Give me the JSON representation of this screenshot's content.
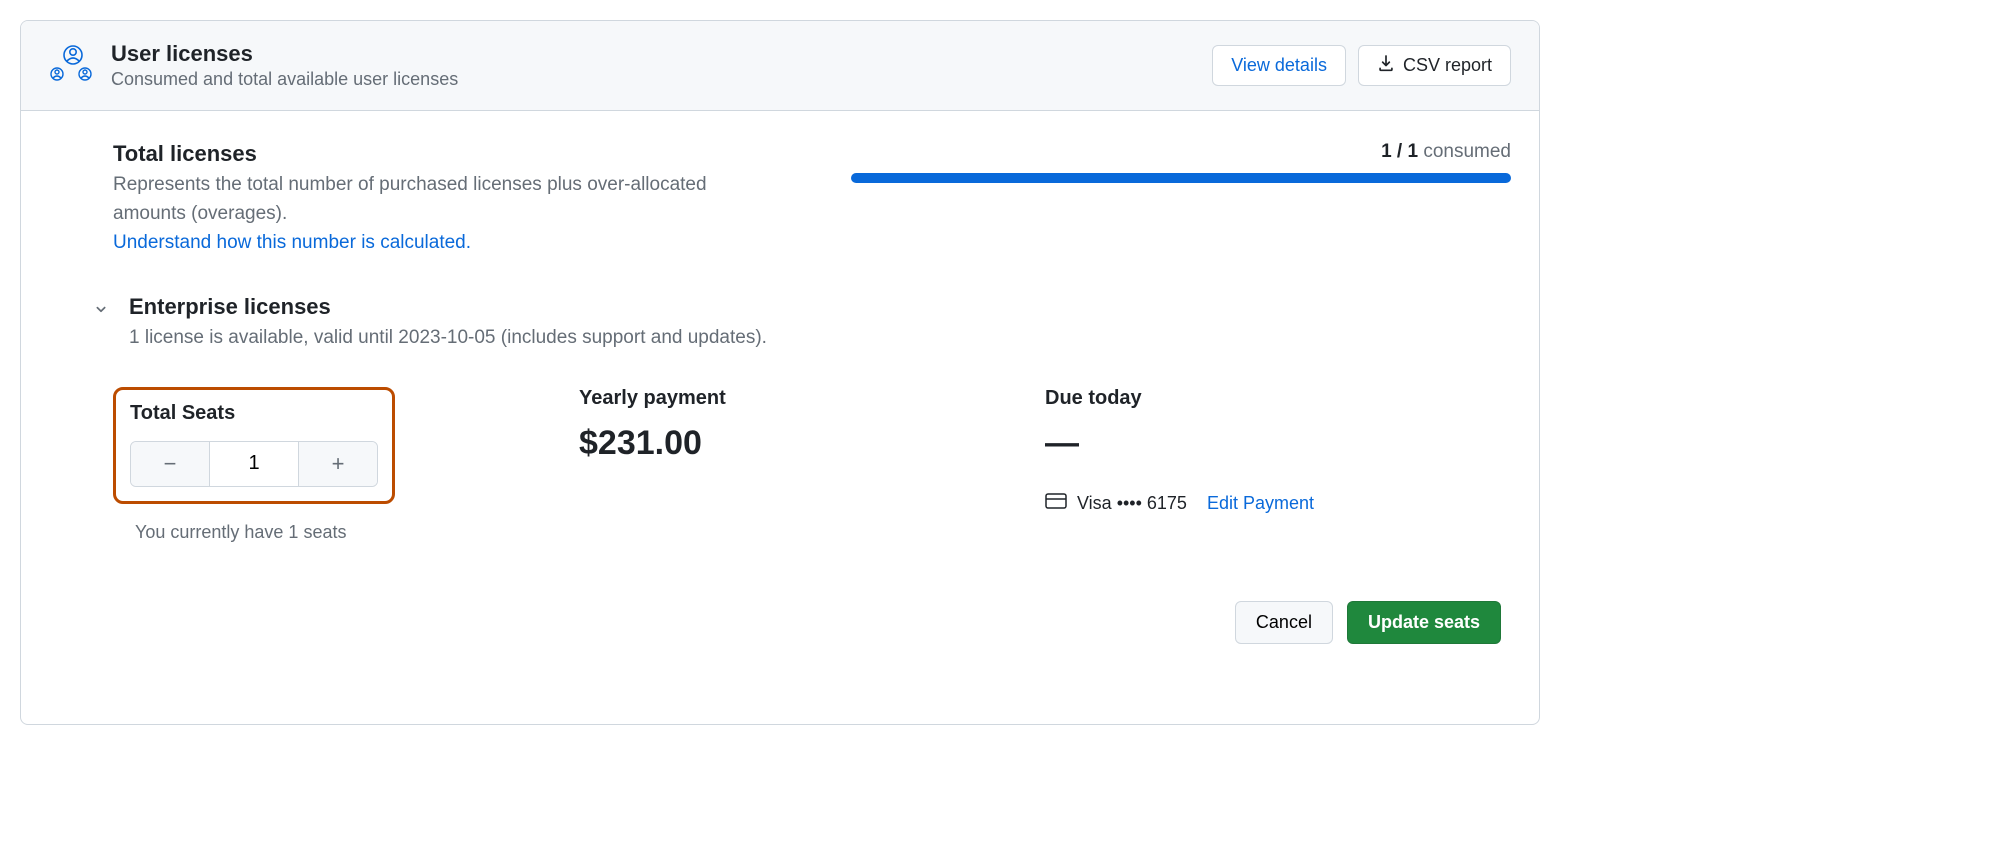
{
  "header": {
    "title": "User licenses",
    "subtitle": "Consumed and total available user licenses",
    "view_details_label": "View details",
    "csv_report_label": "CSV report"
  },
  "total_licenses": {
    "title": "Total licenses",
    "description": "Represents the total number of purchased licenses plus over-allocated amounts (overages).",
    "link_text": "Understand how this number is calculated.",
    "consumed_value": "1 / 1",
    "consumed_suffix": " consumed"
  },
  "enterprise_licenses": {
    "title": "Enterprise licenses",
    "subtitle": "1 license is available, valid until 2023-10-05 (includes support and updates)."
  },
  "seats": {
    "label": "Total Seats",
    "value": "1",
    "note": "You currently have 1 seats"
  },
  "yearly": {
    "label": "Yearly payment",
    "amount": "$231.00"
  },
  "due_today": {
    "label": "Due today",
    "amount": "—",
    "card_text": "Visa •••• 6175",
    "edit_label": "Edit Payment"
  },
  "actions": {
    "cancel": "Cancel",
    "update": "Update seats"
  }
}
